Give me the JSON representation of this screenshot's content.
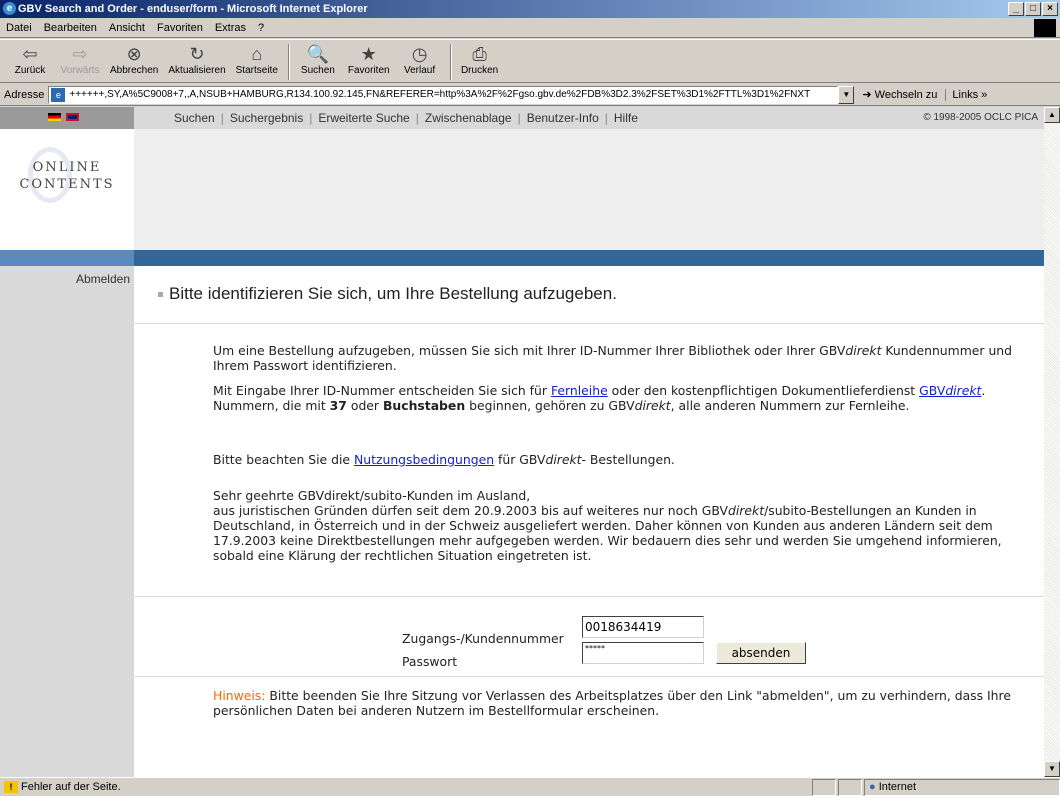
{
  "window": {
    "title": "GBV Search and Order - enduser/form - Microsoft Internet Explorer",
    "controls": {
      "minimize": "_",
      "maximize": "□",
      "close": "×"
    }
  },
  "menu": {
    "items": [
      "Datei",
      "Bearbeiten",
      "Ansicht",
      "Favoriten",
      "Extras",
      "?"
    ]
  },
  "toolbar": {
    "buttons": [
      {
        "label": "Zurück",
        "icon": "back-arrow-icon",
        "glyph": "⇦"
      },
      {
        "label": "Vorwärts",
        "icon": "forward-arrow-icon",
        "glyph": "⇨"
      },
      {
        "label": "Abbrechen",
        "icon": "stop-icon",
        "glyph": "⊗"
      },
      {
        "label": "Aktualisieren",
        "icon": "refresh-icon",
        "glyph": "↻"
      },
      {
        "label": "Startseite",
        "icon": "home-icon",
        "glyph": "⌂"
      },
      {
        "label": "Suchen",
        "icon": "search-icon",
        "glyph": "🔍"
      },
      {
        "label": "Favoriten",
        "icon": "favorites-icon",
        "glyph": "★"
      },
      {
        "label": "Verlauf",
        "icon": "history-icon",
        "glyph": "◷"
      },
      {
        "label": "Drucken",
        "icon": "print-icon",
        "glyph": "⎙"
      }
    ]
  },
  "address": {
    "label": "Adresse",
    "url": "++++++,SY,A%5C9008+7,,A,NSUB+HAMBURG,R134.100.92.145,FN&REFERER=http%3A%2F%2Fgso.gbv.de%2FDB%3D2.3%2FSET%3D1%2FTTL%3D1%2FNXT",
    "go_label": "Wechseln zu",
    "links_label": "Links »"
  },
  "site": {
    "nav": [
      "Suchen",
      "Suchergebnis",
      "Erweiterte Suche",
      "Zwischenablage",
      "Benutzer-Info",
      "Hilfe"
    ],
    "copyright": "© 1998-2005 OCLC PICA",
    "logo": {
      "line1": "ONLINE",
      "line2": "CONTENTS"
    },
    "logout": "Abmelden"
  },
  "content": {
    "heading": "Bitte identifizieren Sie sich, um Ihre Bestellung aufzugeben.",
    "p1": "Um eine Bestellung aufzugeben, müssen Sie sich mit Ihrer ID-Nummer Ihrer Bibliothek oder Ihrer GBV",
    "p1_em": "direkt",
    "p1_tail": " Kundennummer und Ihrem Passwort identifizieren.",
    "p2_a": "Mit Eingabe Ihrer ID-Nummer entscheiden Sie sich für ",
    "p2_link1": "Fernleihe",
    "p2_b": " oder den kostenpflichtigen Dokumentlieferdienst ",
    "p2_link2_a": "GBV",
    "p2_link2_em": "direkt",
    "p2_c": ".",
    "p3_a": "Nummern, die mit ",
    "p3_b1": "37",
    "p3_mid": " oder ",
    "p3_b2": "Buchstaben",
    "p3_c": " beginnen, gehören zu GBV",
    "p3_em": "direkt",
    "p3_d": ", alle anderen Nummern zur Fernleihe.",
    "p4_a": "Bitte beachten Sie die ",
    "p4_link": "Nutzungsbedingungen",
    "p4_b": " für GBV",
    "p4_em": "direkt",
    "p4_c": "- Bestellungen.",
    "p5_l1": "Sehr geehrte GBVdirekt/subito-Kunden im Ausland,",
    "p5_l2a": "aus juristischen Gründen dürfen seit dem 20.9.2003 bis auf weiteres nur noch GBV",
    "p5_l2em": "direkt",
    "p5_l2b": "/subito-Bestellungen an Kunden in Deutschland, in Österreich und in der Schweiz ausgeliefert werden. Daher können von Kunden aus anderen Ländern seit dem 17.9.2003 keine Direktbestellungen mehr aufgegeben werden. Wir bedauern dies sehr und werden Sie umgehend informieren, sobald eine Klärung der rechtlichen Situation eingetreten ist."
  },
  "form": {
    "id_label": "Zugangs-/Kundennummer",
    "id_value": "0018634419",
    "pw_label": "Passwort",
    "pw_value": "*****",
    "submit": "absenden"
  },
  "hint": {
    "label": "Hinweis:",
    "text": " Bitte beenden Sie Ihre Sitzung vor Verlassen des Arbeitsplatzes über den Link \"abmelden\", um zu verhindern, dass Ihre persönlichen Daten bei anderen Nutzern im Bestellformular erscheinen."
  },
  "status": {
    "message": "Fehler auf der Seite.",
    "zone": "Internet"
  }
}
